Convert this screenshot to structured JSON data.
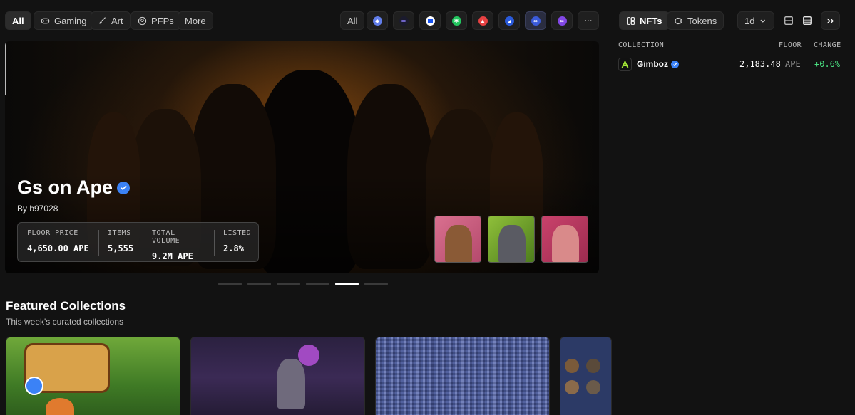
{
  "categories": {
    "all": "All",
    "gaming": "Gaming",
    "art": "Art",
    "pfps": "PFPs",
    "more": "More"
  },
  "chains": {
    "all": "All",
    "items": [
      "ethereum-icon",
      "solana-icon",
      "base-icon",
      "chain-green-icon",
      "avalanche-icon",
      "chain-blue-icon",
      "apechain-icon",
      "polygon-icon"
    ],
    "more": "···"
  },
  "view_toggle": {
    "nfts": "NFTs",
    "tokens": "Tokens"
  },
  "timeframe": {
    "value": "1d"
  },
  "table": {
    "headers": {
      "collection": "COLLECTION",
      "floor": "FLOOR",
      "change": "CHANGE"
    },
    "rows": [
      {
        "name": "Gimboz",
        "floor": "2,183.48",
        "unit": "APE",
        "change": "+0.6%"
      }
    ]
  },
  "hero": {
    "title": "Gs on Ape",
    "by": "By b97028",
    "stats": [
      {
        "label": "FLOOR PRICE",
        "value": "4,650.00 APE"
      },
      {
        "label": "ITEMS",
        "value": "5,555"
      },
      {
        "label": "TOTAL VOLUME",
        "value": "9.2M APE"
      },
      {
        "label": "LISTED",
        "value": "2.8%"
      }
    ],
    "active_slide": 5,
    "slide_count": 6
  },
  "featured": {
    "title": "Featured Collections",
    "subtitle": "This week's curated collections"
  },
  "colors": {
    "accent_blue": "#3b82f6",
    "positive": "#4ade80",
    "background": "#121212"
  }
}
